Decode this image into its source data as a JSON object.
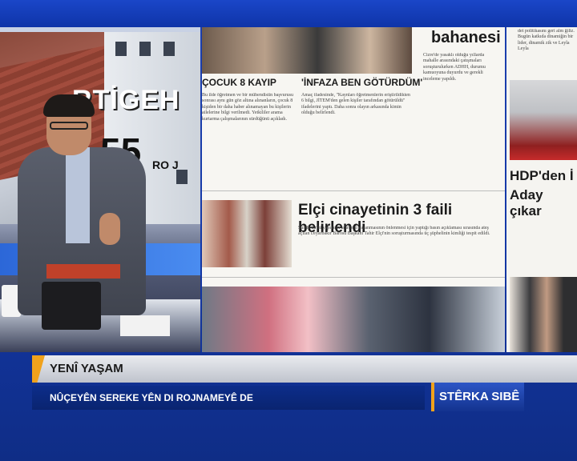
{
  "studio": {
    "photo_word": "RTİGEH",
    "photo_number": "55",
    "photo_small": "RO J"
  },
  "newspaper": {
    "col1_headline": "ÇOCUK 8 KAYIP",
    "col2_headline": "'İNFAZA BEN GÖTÜRDÜM'",
    "col3_headline": "bahanesi",
    "main_headline": "Elçi cinayetinin 3 faili belirlendi",
    "col1_text": "Bu ilde öğretmen ve bir mühendistin başvurusu sonrası aynı gün göz altına alınanların, çocuk 8 kişiden bir daha haber alınamayan bu kişilerin ailelerine bilgi verilmedi. Yetkililer arama kurtarma çalışmalarının sürdüğünü açıkladı.",
    "col2_text": "Amaç ifadesinde, \"Kaynları öğretmenlerin eriştirildikten 6 bilgi, JİTEM'den gelen kişiler tarafından götürüldü\" ifadelerini yaptı. Daha sonra olayın arkasında kimin olduğu belirlendi.",
    "col3_text": "Cizre'de yasaklı olduğu yıllarda mahalle arasındaki çatışmaları soruşturulurken ADHH, durumu kamuoyuna duyurdu ve gerekli inceleme yapıldı.",
    "main_text": "Sur'da tarihi yapıların tahribini yaşanmasının önlenmesi için yaptığı basın açıklaması sırasında ateş açılan Diyarbakır Barosu Başkanı Tahir Elçi'nin soruşturmasında üç şüphelinin kimliği tespit edildi."
  },
  "right_page": {
    "headline_1": "HDP'den İ",
    "headline_2": "Aday çıkar",
    "snippet_top": "det politikasını geri alm ğiliz. Bugün katkıda dinamiğin bir lider, dinamik zik ve Leyla Leyla"
  },
  "lower_third": {
    "program_title": "YENÎ YAŞAM",
    "ticker_text": "NÛÇEYÊN SEREKE YÊN DI ROJNAMEYÊ DE",
    "channel_logo": "STÊRKA SIBÊ"
  },
  "colors": {
    "accent": "#f0a21c",
    "ticker_blue": "#0c2d8a",
    "headline_red": "#b3261e"
  }
}
